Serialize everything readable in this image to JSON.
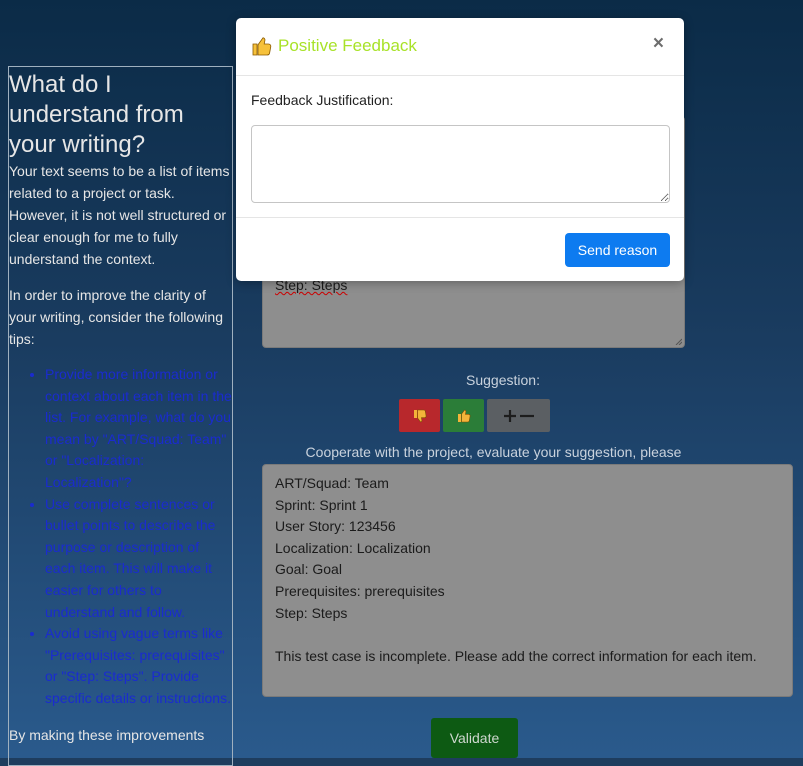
{
  "left_panel": {
    "title": "What do I understand from your writing?",
    "para1": "Your text seems to be a list of items related to a project or task. However, it is not well structured or clear enough for me to fully understand the context.",
    "para2": "In order to improve the clarity of your writing, consider the following tips:",
    "tips": [
      "Provide more information or context about each item in the list. For example, what do you mean by \"ART/Squad: Team\" or \"Localization: Localization\"?",
      "Use complete sentences or bullet points to describe the purpose or description of each item. This will make it easier for others to understand and follow.",
      "Avoid using vague terms like \"Prerequisites: prerequisites\" or \"Step: Steps\". Provide specific details or instructions."
    ],
    "tail": "By making these improvements"
  },
  "upper_textarea": {
    "visible_line": "Step: Steps"
  },
  "suggestion": {
    "label": "Suggestion:",
    "buttons": {
      "negative_icon": "thumbs-down-icon",
      "positive_icon": "thumbs-up-icon",
      "plusminus_icon": "plus-minus-icon"
    }
  },
  "cooperate_label": "Cooperate with the project, evaluate your suggestion, please",
  "main_textarea": {
    "value": "ART/Squad: Team\nSprint: Sprint 1\nUser Story: 123456\nLocalization: Localization\nGoal: Goal\nPrerequisites: prerequisites\nStep: Steps\n\nThis test case is incomplete. Please add the correct information for each item."
  },
  "validate_button": "Validate",
  "modal": {
    "icon": "thumbs-up-icon",
    "title": "Positive Feedback",
    "close": "×",
    "justification_label": "Feedback Justification:",
    "justification_value": "",
    "send_button": "Send reason"
  },
  "colors": {
    "modal_title": "#a8e228",
    "send_button": "#0d7bf0",
    "validate_button": "#0d5a13",
    "negative_button": "#b8282c",
    "positive_button": "#2b7d38"
  }
}
